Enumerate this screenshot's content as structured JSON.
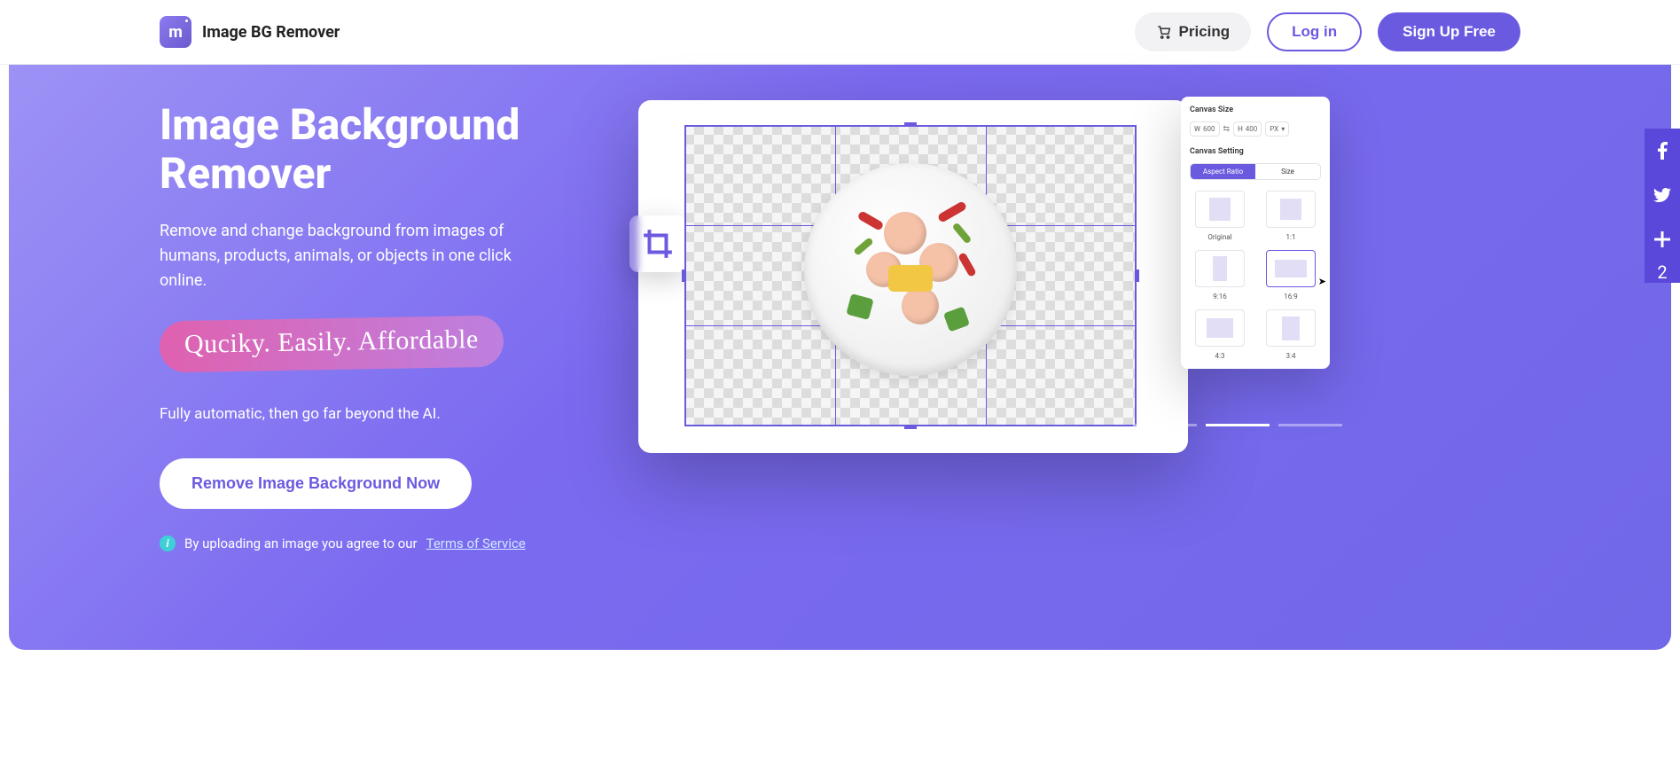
{
  "header": {
    "brand": "Image BG Remover",
    "pricing": "Pricing",
    "login": "Log in",
    "signup": "Sign Up Free"
  },
  "hero": {
    "title_l1": "Image Background",
    "title_l2": "Remover",
    "subtitle": "Remove and change background from images of humans, products, animals, or objects in one click online.",
    "tagline": "Quciky. Easily. Affordable",
    "subtitle2": "Fully automatic, then go far beyond the AI.",
    "cta": "Remove Image Background Now",
    "tos_prefix": "By uploading an image you agree to our  ",
    "tos_link": "Terms of Service"
  },
  "panel": {
    "size_title": "Canvas Size",
    "w_label": "W",
    "w_value": "600",
    "h_label": "H",
    "h_value": "400",
    "unit": "PX",
    "setting_title": "Canvas Setting",
    "tab_ratio": "Aspect Ratio",
    "tab_size": "Size",
    "ratios": {
      "original": "Original",
      "r11": "1:1",
      "r916": "9:16",
      "r169": "16:9",
      "r43": "4:3",
      "r34": "3:4"
    }
  },
  "social": {
    "share_count": "2"
  }
}
